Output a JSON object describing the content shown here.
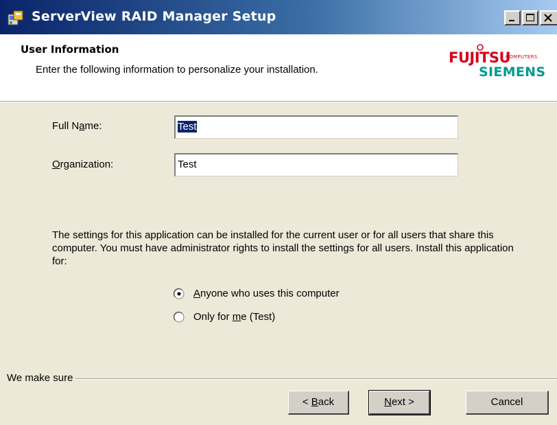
{
  "window": {
    "title": "ServerView RAID Manager Setup",
    "controls": [
      "minimize-icon",
      "maximize-icon",
      "close-icon"
    ]
  },
  "header": {
    "title": "User Information",
    "subtitle": "Enter the following information to personalize your installation.",
    "logo": {
      "line1": "FUJITSU",
      "line1_small": "COMPUTERS",
      "line2": "SIEMENS",
      "colors": {
        "fujitsu": "#d6001c",
        "siemens": "#009b8d"
      }
    }
  },
  "form": {
    "full_name_label_pre": "Full N",
    "full_name_label_key": "a",
    "full_name_label_post": "me:",
    "full_name_value": "Test",
    "organization_label_key": "O",
    "organization_label_post": "rganization:",
    "organization_value": "Test"
  },
  "install_scope": {
    "description": "The settings for this application can be installed for the current user or for all users that share this computer. You must have administrator rights to install the settings for all users. Install this application for:",
    "options": [
      {
        "key": "A",
        "rest": "nyone who uses this computer",
        "selected": true
      },
      {
        "pre": "Only for ",
        "key": "m",
        "rest": "e (Test)",
        "selected": false
      }
    ]
  },
  "footer": {
    "group_label": "We make sure",
    "back_pre": "< ",
    "back_key": "B",
    "back_rest": "ack",
    "next_key": "N",
    "next_rest": "ext >",
    "cancel": "Cancel"
  },
  "colors": {
    "title_bar_start": "#0a246a",
    "title_bar_end": "#a6caf0",
    "dialog_bg": "#ece9d8",
    "selection": "#0a246a"
  }
}
